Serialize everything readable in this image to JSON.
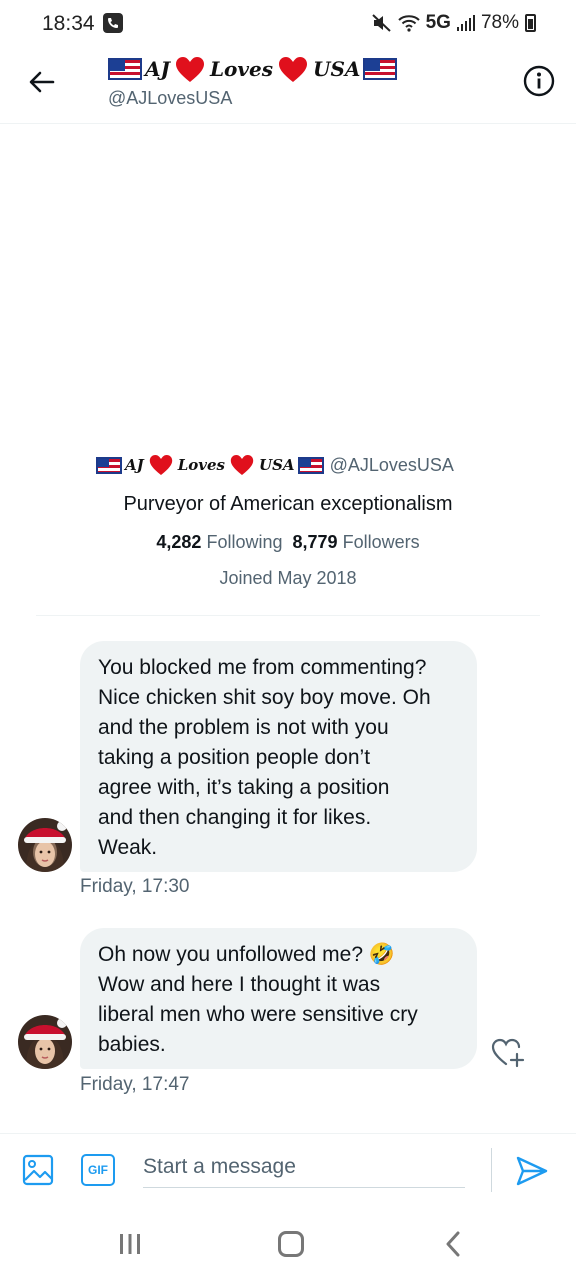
{
  "status_bar": {
    "time": "18:34",
    "network": "5G",
    "battery": "78%"
  },
  "header": {
    "display_name_parts": [
      "AJ",
      "Loves",
      "USA"
    ],
    "handle": "@AJLovesUSA"
  },
  "profile": {
    "display_name_parts": [
      "AJ",
      "Loves",
      "USA"
    ],
    "handle": "@AJLovesUSA",
    "bio": "Purveyor of American exceptionalism",
    "following_count": "4,282",
    "following_label": "Following",
    "followers_count": "8,779",
    "followers_label": "Followers",
    "joined": "Joined May 2018"
  },
  "messages": [
    {
      "lines": [
        "You blocked me from commenting?",
        "Nice chicken shit soy boy move. Oh",
        "and the problem is not with you",
        "taking a position people don’t",
        "agree with, it’s taking a position",
        "and then changing it for likes.",
        "Weak."
      ],
      "time": "Friday, 17:30"
    },
    {
      "lines": [
        "Oh now you unfollowed me? 🤣",
        "Wow and here I thought it was",
        "liberal men who were sensitive cry",
        "babies."
      ],
      "time": "Friday, 17:47"
    }
  ],
  "composer": {
    "placeholder": "Start a message",
    "gif_label": "GIF"
  },
  "colors": {
    "accent": "#1d9bf0",
    "bubble": "#eff3f4",
    "heart": "#e0101c",
    "flag_red": "#c8102e",
    "flag_blue": "#1c3f94"
  },
  "icons": [
    "back-arrow-icon",
    "info-icon",
    "image-icon",
    "gif-icon",
    "send-icon",
    "add-reaction-icon",
    "nav-recent-icon",
    "nav-home-icon",
    "nav-back-icon"
  ]
}
